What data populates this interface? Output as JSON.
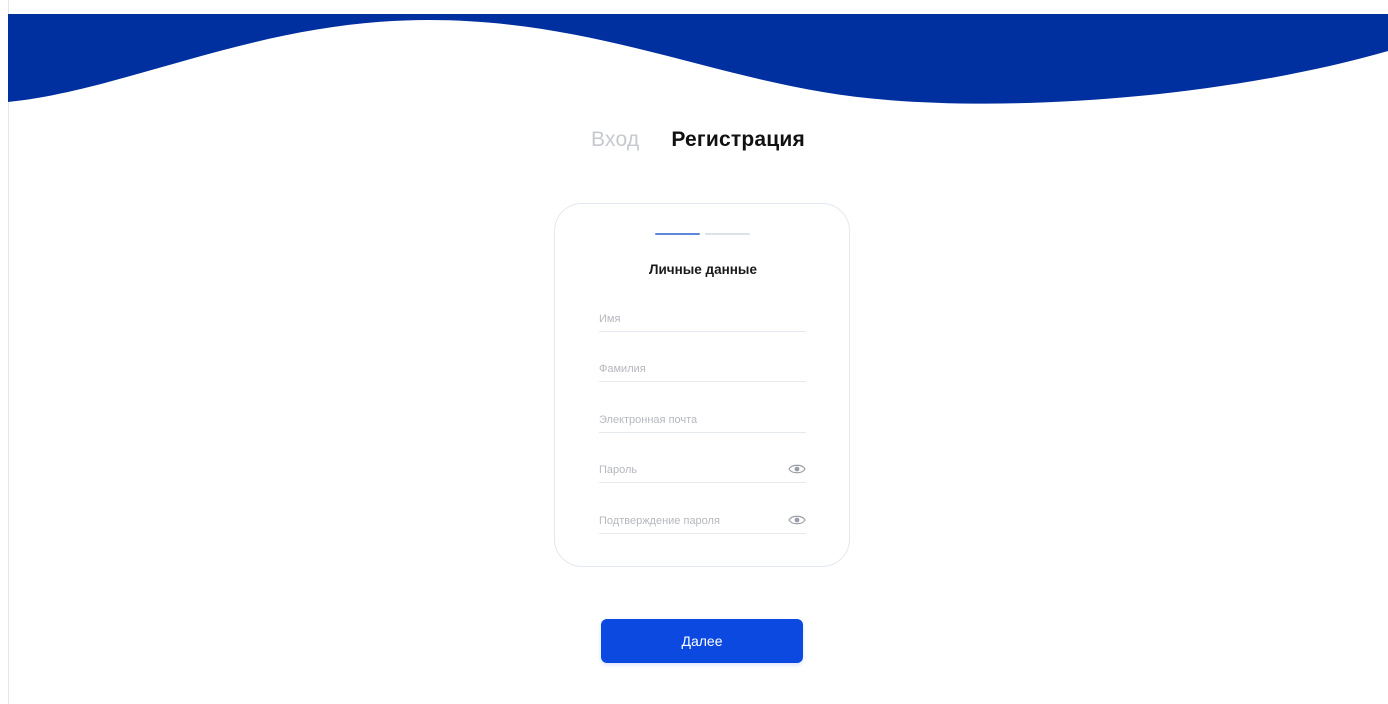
{
  "theme": {
    "brand_wave": "#002fa0",
    "primary_button": "#0c49e1",
    "step_active": "#5c87dc",
    "step_inactive": "#dde2ea"
  },
  "tabs": {
    "login_label": "Вход",
    "register_label": "Регистрация",
    "active": "register"
  },
  "stepper": {
    "total_steps": 2,
    "current_step": 1
  },
  "form": {
    "title": "Личные данные",
    "fields": {
      "first_name": {
        "placeholder": "Имя",
        "value": ""
      },
      "last_name": {
        "placeholder": "Фамилия",
        "value": ""
      },
      "email": {
        "placeholder": "Электронная почта",
        "value": ""
      },
      "password": {
        "placeholder": "Пароль",
        "value": "",
        "icon": "eye-icon"
      },
      "password_confirm": {
        "placeholder": "Подтверждение пароля",
        "value": "",
        "icon": "eye-icon"
      }
    }
  },
  "actions": {
    "next_label": "Далее"
  }
}
